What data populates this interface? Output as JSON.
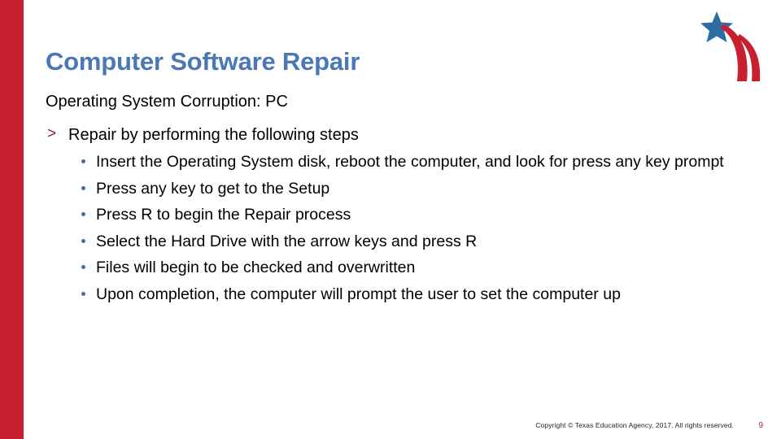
{
  "slide": {
    "title": "Computer Software Repair",
    "subtitle": "Operating System Corruption: PC",
    "accent_color": "#C8202F",
    "title_color": "#4A78B5",
    "bullet_color": "#4A6A97",
    "marker_color": "#8B2230"
  },
  "content": {
    "level1": {
      "marker": ">",
      "text": "Repair by performing the following steps"
    },
    "level2": [
      {
        "text": "Insert the Operating System disk, reboot the computer, and look for press any key prompt"
      },
      {
        "text": "Press any key to get to the Setup"
      },
      {
        "text": "Press R to begin the Repair process"
      },
      {
        "text": "Select the Hard Drive with the arrow keys and press R"
      },
      {
        "text": "Files will begin to be checked and overwritten"
      },
      {
        "text": "Upon completion, the computer will prompt the user to set the computer up"
      }
    ]
  },
  "logo": {
    "name": "texas-education-agency-logo",
    "star_color": "#2E6DA4",
    "swoosh_color": "#C8202F"
  },
  "footer": {
    "copyright": "Copyright © Texas Education Agency, 2017. All rights reserved.",
    "page_number": "9"
  }
}
